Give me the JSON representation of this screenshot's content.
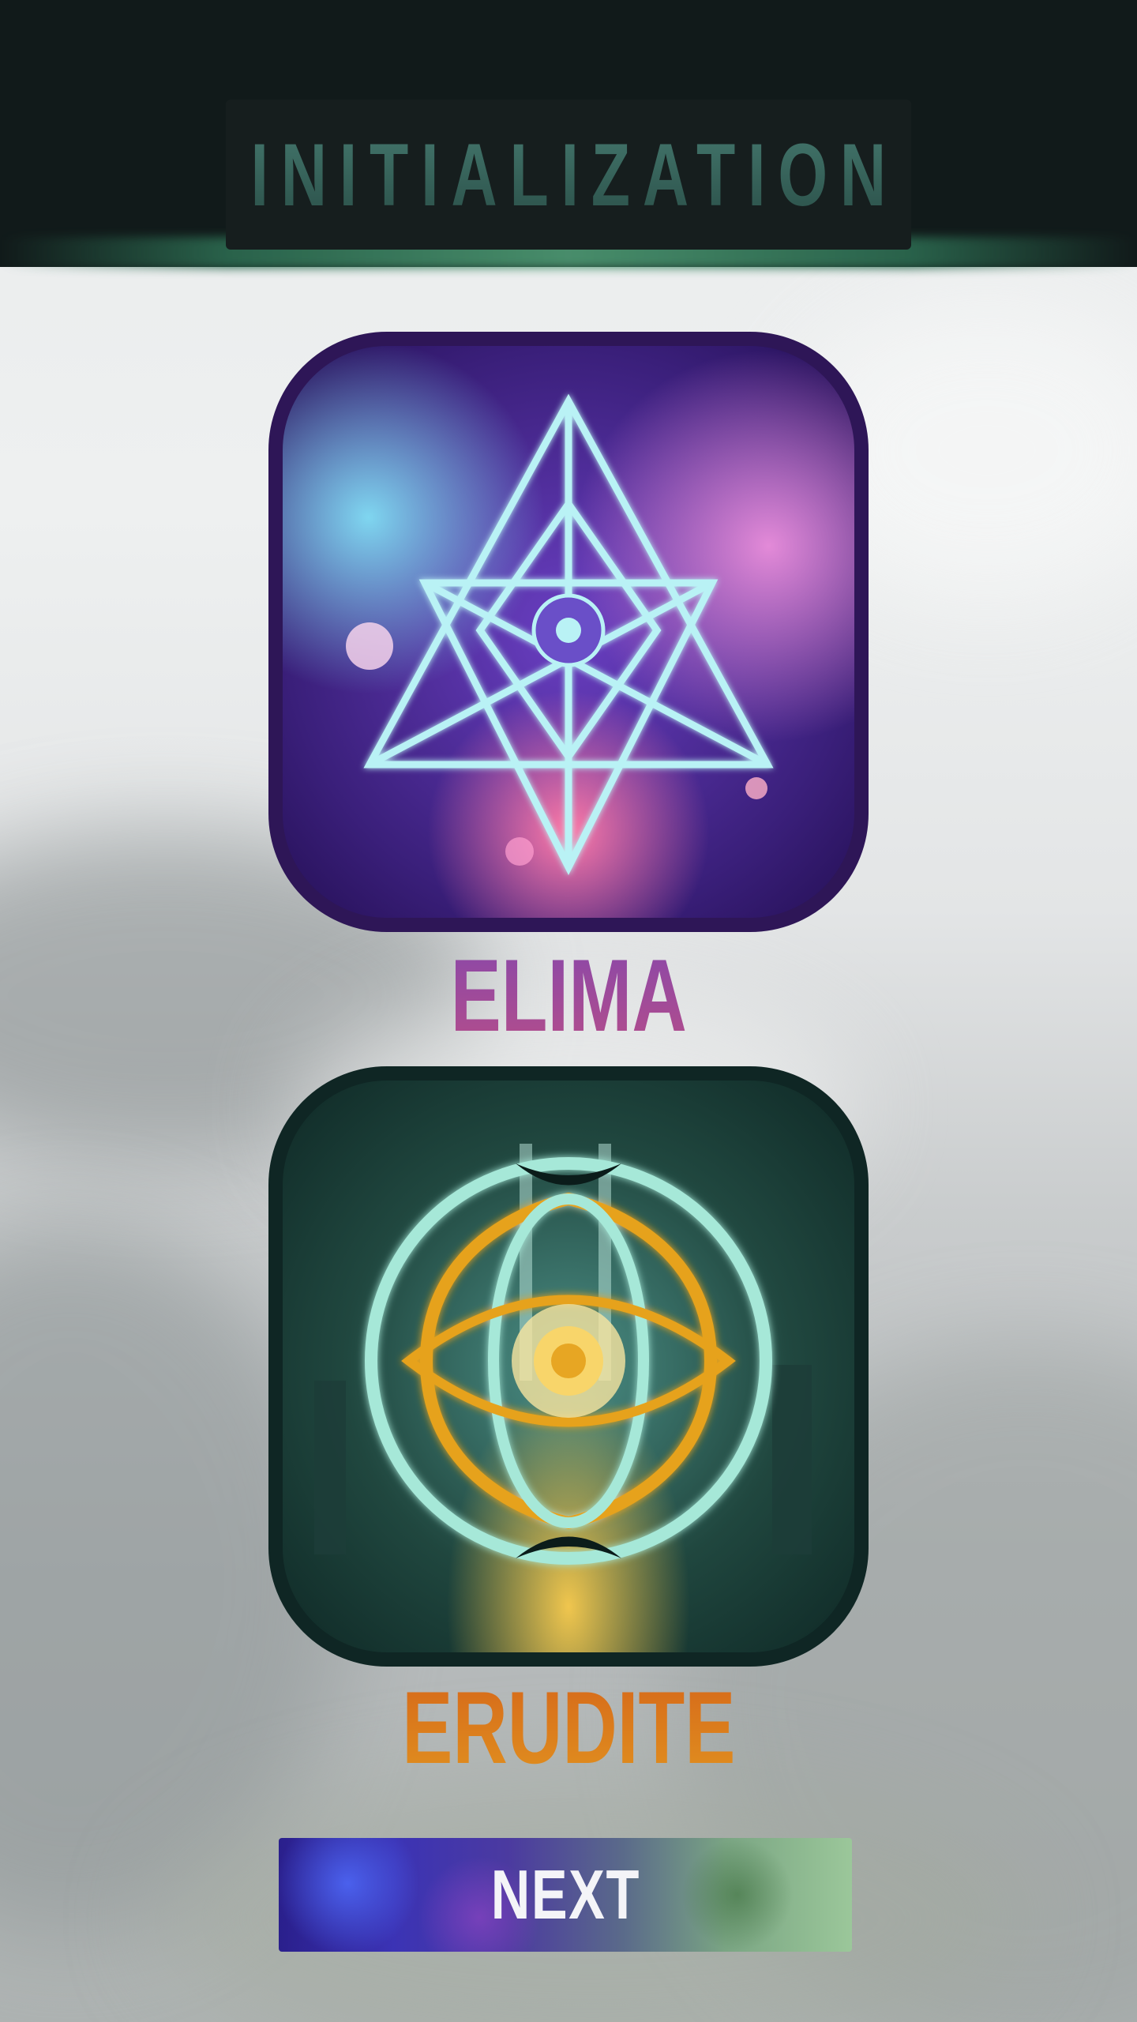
{
  "header": {
    "title": "INITIALIZATION"
  },
  "factions": [
    {
      "name": "ELIMA",
      "emblem": "triangle-star-emblem-icon"
    },
    {
      "name": "ERUDITE",
      "emblem": "eye-rings-emblem-icon"
    }
  ],
  "actions": {
    "next_label": "NEXT"
  },
  "colors": {
    "header_bg": "#111a1a",
    "title": "#3d6b62",
    "elima": "#9a4a9e",
    "erudite": "#dd7a1c",
    "next_text": "#f4f4f8"
  }
}
